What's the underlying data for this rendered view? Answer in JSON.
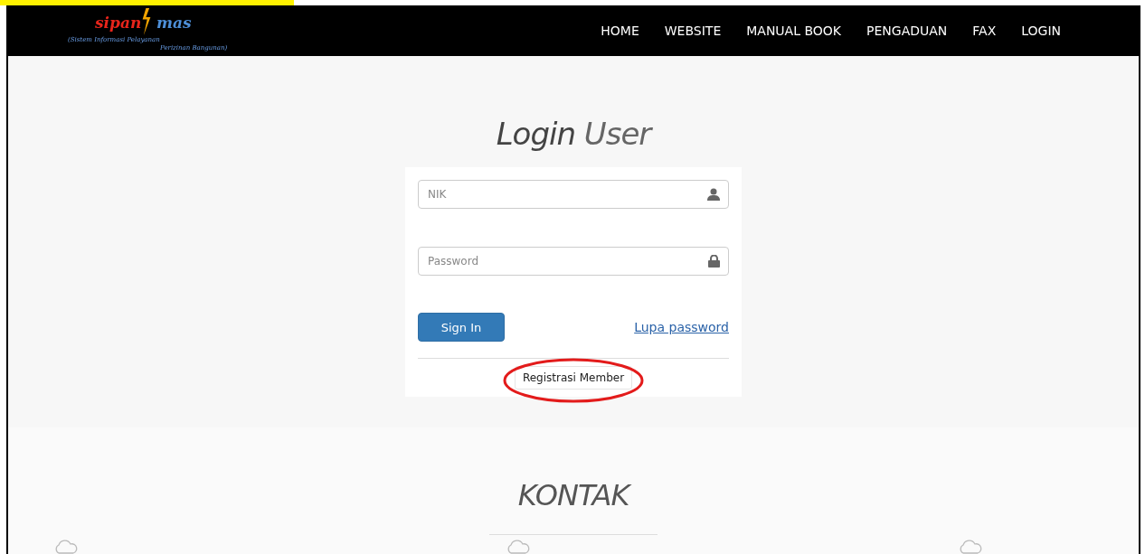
{
  "logo": {
    "name_start": "sipan",
    "name_end": "mas",
    "tagline": [
      "(Sistem Informasi Pelayanan",
      "Perizinan Bangunan)"
    ]
  },
  "nav": [
    {
      "label": "HOME"
    },
    {
      "label": "WEBSITE"
    },
    {
      "label": "MANUAL BOOK"
    },
    {
      "label": "PENGADUAN"
    },
    {
      "label": "FAX"
    },
    {
      "label": "LOGIN"
    }
  ],
  "login": {
    "title": "**Login** User",
    "fields": [
      {
        "placeholder": "NIK",
        "kind": "user"
      },
      {
        "placeholder": "Password",
        "kind": "lock"
      }
    ],
    "sign_in": "Sign In",
    "forgot": "Lupa password",
    "register": "Registrasi Member",
    "register_highlighted": true
  },
  "contact": {
    "title": "KONTAK",
    "items": [
      {
        "kind": "cloud"
      },
      {
        "kind": "cloud"
      },
      {
        "kind": "cloud"
      }
    ]
  }
}
